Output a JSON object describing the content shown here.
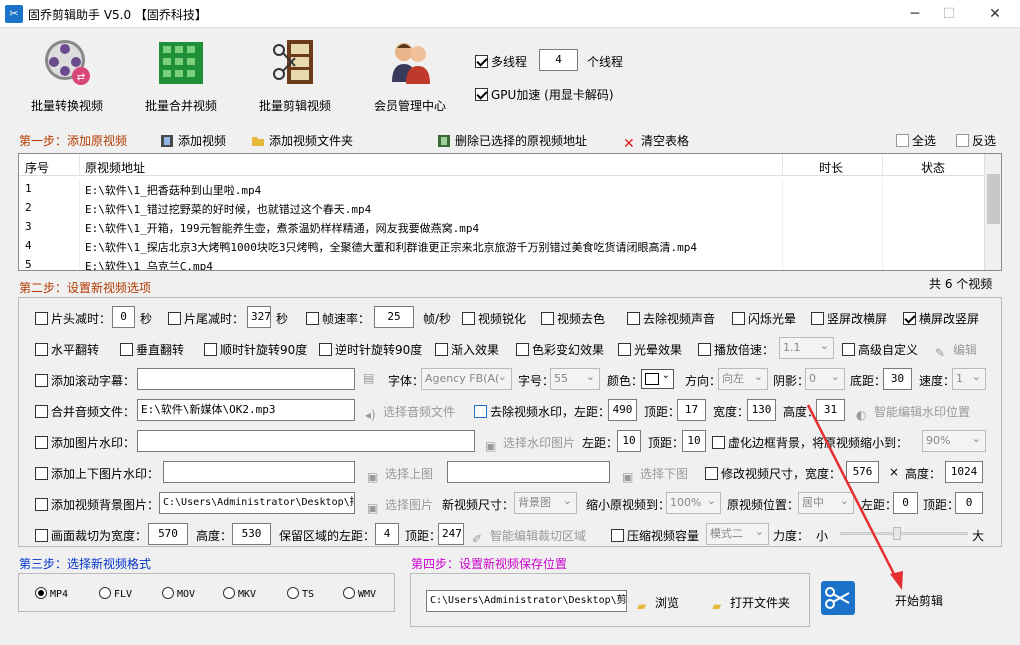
{
  "title": "固乔剪辑助手 V5.0  【固乔科技】",
  "toolbar": {
    "batch_convert": "批量转换视频",
    "batch_merge": "批量合并视频",
    "batch_edit": "批量剪辑视频",
    "member": "会员管理中心"
  },
  "opts": {
    "multithread": "多线程",
    "threads": "4",
    "threads_unit": "个线程",
    "gpu": "GPU加速 (用显卡解码)"
  },
  "step1": {
    "label": "第一步：添加原视频",
    "add_video": "添加视频",
    "add_folder": "添加视频文件夹",
    "delete_selected": "删除已选择的原视频地址",
    "clear_table": "清空表格",
    "select_all": "全选",
    "invert": "反选"
  },
  "table": {
    "headers": {
      "no": "序号",
      "path": "原视频地址",
      "duration": "时长",
      "status": "状态"
    },
    "rows": [
      {
        "no": "1",
        "path": "E:\\软件\\1_把香菇种到山里啦.mp4"
      },
      {
        "no": "2",
        "path": "E:\\软件\\1_错过挖野菜的好时候，也就错过这个春天.mp4"
      },
      {
        "no": "3",
        "path": "E:\\软件\\1_开箱，199元智能养生壶，煮茶温奶样样精通，网友我要做燕窝.mp4"
      },
      {
        "no": "4",
        "path": "E:\\软件\\1_探店北京3大烤鸭1000块吃3只烤鸭，全聚德大董和利群谁更正宗来北京旅游千万别错过美食吃货请闭眼高清.mp4"
      },
      {
        "no": "5",
        "path": "E:\\软件\\1_乌克兰C.mp4"
      }
    ],
    "total": "共 6 个视频"
  },
  "step2": {
    "label": "第二步：设置新视频选项",
    "head_cut": "片头减时：",
    "head_val": "0",
    "sec1": "秒",
    "tail_cut": "片尾减时：",
    "tail_val": "327",
    "sec2": "秒",
    "fps": "帧速率：",
    "fps_val": "25",
    "fps_unit": "帧/秒",
    "sharpen": "视频锐化",
    "decolor": "视频去色",
    "remove_audio": "去除视频声音",
    "flash": "闪烁光晕",
    "v2h": "竖屏改横屏",
    "h2v": "横屏改竖屏",
    "hflip": "水平翻转",
    "vflip": "垂直翻转",
    "rot_cw": "顺时针旋转90度",
    "rot_ccw": "逆时针旋转90度",
    "fade": "渐入效果",
    "color_shift": "色彩变幻效果",
    "glow": "光晕效果",
    "speed": "播放倍速：",
    "speed_val": "1.1",
    "advanced": "高级自定义",
    "edit": "编辑",
    "scroll_sub": "添加滚动字幕：",
    "font": "字体：",
    "font_val": "Agency FB(A(",
    "size": "字号：",
    "size_val": "55",
    "color": "颜色：",
    "direction": "方向：",
    "direction_val": "向左",
    "shadow": "阴影：",
    "shadow_val": "0",
    "bottom": "底距：",
    "bottom_val": "30",
    "speed2": "速度：",
    "speed2_val": "1",
    "merge_audio": "合并音频文件：",
    "audio_path": "E:\\软件\\新媒体\\OK2.mp3",
    "choose_audio": "选择音频文件",
    "remove_wm": "去除视频水印，左距：",
    "wm_left": "490",
    "top": "顶距：",
    "wm_top": "17",
    "width": "宽度：",
    "wm_w": "130",
    "height": "高度：",
    "wm_h": "31",
    "smart_wm": "智能编辑水印位置",
    "img_wm": "添加图片水印：",
    "choose_wm_img": "选择水印图片",
    "left": "左距：",
    "img_left": "10",
    "img_top": "10",
    "blur_bg": "虚化边框背景，将原视频缩小到：",
    "blur_val": "90%",
    "tb_img": "添加上下图片水印：",
    "choose_top": "选择上图",
    "choose_bottom": "选择下图",
    "resize": "修改视频尺寸，宽度：",
    "resize_w": "576",
    "times": "×",
    "height2": "高度：",
    "resize_h": "1024",
    "bg_img": "添加视频背景图片：",
    "bg_path": "C:\\Users\\Administrator\\Desktop\\抖",
    "choose_img": "选择图片",
    "new_size": "新视频尺寸：",
    "new_size_val": "背景图",
    "shrink": "缩小原视频到：",
    "shrink_val": "100%",
    "position": "原视频位置：",
    "position_val": "居中",
    "left2": "左距：",
    "pos_left": "0",
    "top2": "顶距：",
    "pos_top": "0",
    "crop": "画面裁切为宽度：",
    "crop_w": "570",
    "crop_h_lbl": "高度：",
    "crop_h": "530",
    "keep_left": "保留区域的左距：",
    "keep_left_val": "4",
    "top3": "顶距：",
    "keep_top": "247",
    "smart_crop": "智能编辑裁切区域",
    "compress": "压缩视频容量",
    "compress_mode": "模式二",
    "strength": "力度：",
    "small": "小",
    "big": "大"
  },
  "step3": {
    "label": "第三步：选择新视频格式",
    "formats": [
      "MP4",
      "FLV",
      "MOV",
      "MKV",
      "TS",
      "WMV"
    ]
  },
  "step4": {
    "label": "第四步：设置新视频保存位置",
    "path": "C:\\Users\\Administrator\\Desktop\\剪",
    "browse": "浏览",
    "open_folder": "打开文件夹"
  },
  "start": "开始剪辑",
  "colors": {
    "step_color": "#b33a00",
    "step3_color": "#0033cc",
    "step4_color": "#cc00cc",
    "arrow": "#e63030"
  }
}
